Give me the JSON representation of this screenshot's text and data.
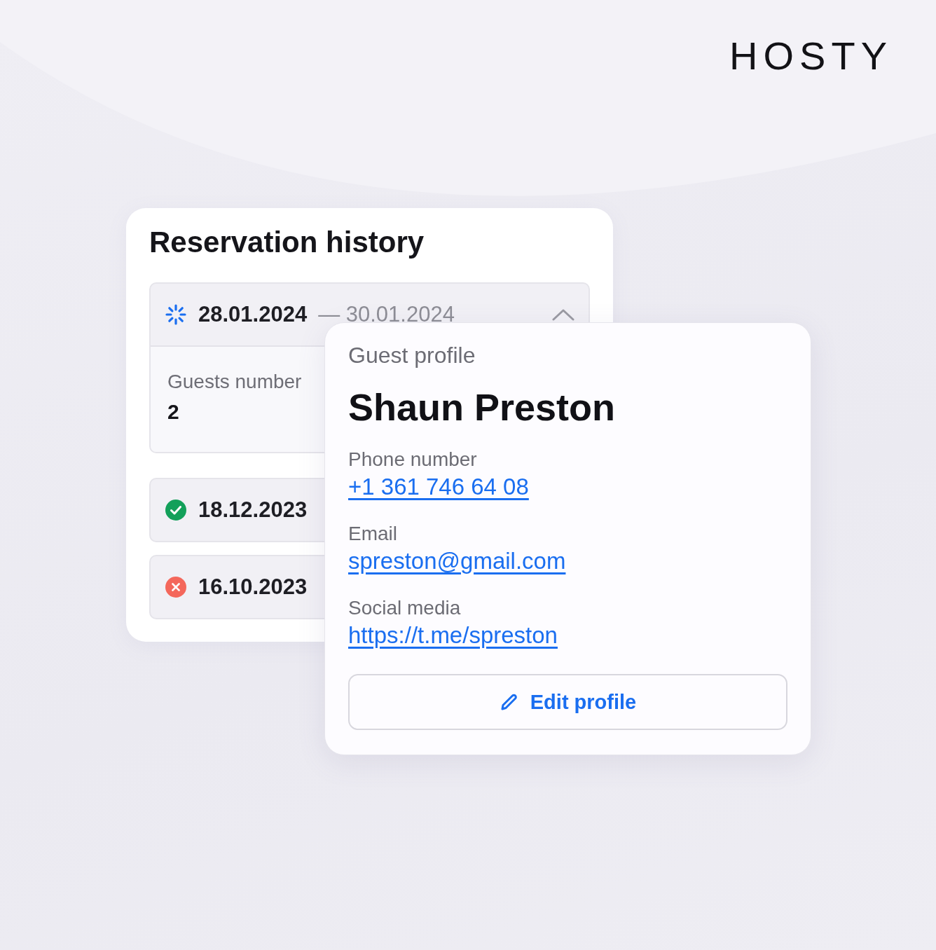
{
  "logo": {
    "text": "HOSTY"
  },
  "reservation_history": {
    "title": "Reservation history",
    "reservations": [
      {
        "kind": "in_progress",
        "start": "28.01.2024",
        "end": "— 30.01.2024",
        "expanded": true,
        "details": [
          {
            "label": "Guests number",
            "value": "2"
          }
        ]
      },
      {
        "kind": "completed",
        "start": "18.12.2023",
        "expanded": false
      },
      {
        "kind": "cancelled",
        "start": "16.10.2023",
        "expanded": false
      }
    ]
  },
  "guest_profile": {
    "heading": "Guest profile",
    "name": "Shaun Preston",
    "fields": [
      {
        "label": "Phone number",
        "value": "+1 361 746 64 08"
      },
      {
        "label": "Email",
        "value": "spreston@gmail.com"
      },
      {
        "label": "Social media",
        "value": "https://t.me/spreston"
      }
    ],
    "button": "Edit profile"
  }
}
